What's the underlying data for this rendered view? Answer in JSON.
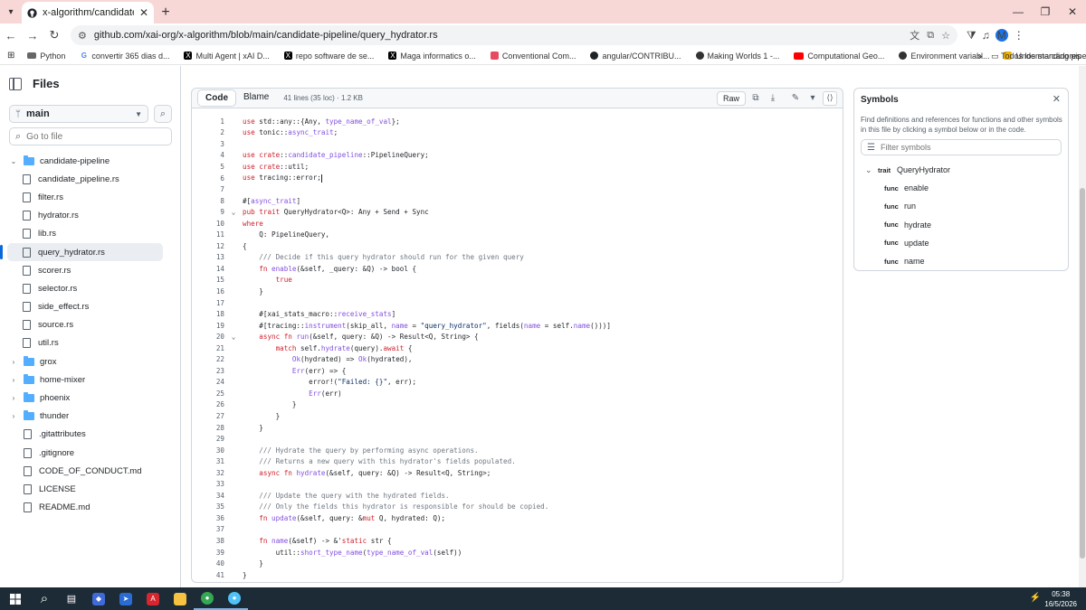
{
  "browser": {
    "tab_title": "x-algorithm/candidate-pipeline",
    "url": "github.com/xai-org/x-algorithm/blob/main/candidate-pipeline/query_hydrator.rs",
    "profile_initial": "M",
    "window_controls": [
      "—",
      "❐",
      "✕"
    ]
  },
  "bookmarks": {
    "items": [
      {
        "label": "Python",
        "icon": "folder-icon"
      },
      {
        "label": "convertir 365 dias d...",
        "icon": "google-icon"
      },
      {
        "label": "Multi Agent | xAI D...",
        "icon": "x-icon"
      },
      {
        "label": "repo software de se...",
        "icon": "x-icon"
      },
      {
        "label": "Maga informatics o...",
        "icon": "x-icon"
      },
      {
        "label": "Conventional Com...",
        "icon": "page-icon"
      },
      {
        "label": "angular/CONTRIBU...",
        "icon": "github-icon"
      },
      {
        "label": "Making Worlds 1 -...",
        "icon": "globe-icon"
      },
      {
        "label": "Computational Geo...",
        "icon": "youtube-icon"
      },
      {
        "label": "Environment variabl...",
        "icon": "cloud-icon"
      },
      {
        "label": "Understanding pipe...",
        "icon": "page-icon"
      }
    ],
    "all_bookmarks": "Todos los marcadores"
  },
  "sidebar": {
    "title": "Files",
    "branch": "main",
    "go_to_file_placeholder": "Go to file",
    "tree": [
      {
        "label": "candidate-pipeline",
        "type": "folder",
        "open": true,
        "depth": 0
      },
      {
        "label": "candidate_pipeline.rs",
        "type": "file",
        "depth": 1
      },
      {
        "label": "filter.rs",
        "type": "file",
        "depth": 1
      },
      {
        "label": "hydrator.rs",
        "type": "file",
        "depth": 1
      },
      {
        "label": "lib.rs",
        "type": "file",
        "depth": 1
      },
      {
        "label": "query_hydrator.rs",
        "type": "file",
        "depth": 1,
        "selected": true
      },
      {
        "label": "scorer.rs",
        "type": "file",
        "depth": 1
      },
      {
        "label": "selector.rs",
        "type": "file",
        "depth": 1
      },
      {
        "label": "side_effect.rs",
        "type": "file",
        "depth": 1
      },
      {
        "label": "source.rs",
        "type": "file",
        "depth": 1
      },
      {
        "label": "util.rs",
        "type": "file",
        "depth": 1
      },
      {
        "label": "grox",
        "type": "folder",
        "open": false,
        "depth": 0
      },
      {
        "label": "home-mixer",
        "type": "folder",
        "open": false,
        "depth": 0
      },
      {
        "label": "phoenix",
        "type": "folder",
        "open": false,
        "depth": 0
      },
      {
        "label": "thunder",
        "type": "folder",
        "open": false,
        "depth": 0
      },
      {
        "label": ".gitattributes",
        "type": "file",
        "depth": 0
      },
      {
        "label": ".gitignore",
        "type": "file",
        "depth": 0
      },
      {
        "label": "CODE_OF_CONDUCT.md",
        "type": "file",
        "depth": 0
      },
      {
        "label": "LICENSE",
        "type": "file",
        "depth": 0
      },
      {
        "label": "README.md",
        "type": "file",
        "depth": 0
      }
    ]
  },
  "code_view": {
    "tab_code": "Code",
    "tab_blame": "Blame",
    "meta": "41 lines (35 loc) · 1.2 KB",
    "raw_label": "Raw",
    "lines": [
      "use std::any::{Any, type_name_of_val};",
      "use tonic::async_trait;",
      "",
      "use crate::candidate_pipeline::PipelineQuery;",
      "use crate::util;",
      "use tracing::error;",
      "",
      "#[async_trait]",
      "pub trait QueryHydrator<Q>: Any + Send + Sync",
      "where",
      "    Q: PipelineQuery,",
      "{",
      "    /// Decide if this query hydrator should run for the given query",
      "    fn enable(&self, _query: &Q) -> bool {",
      "        true",
      "    }",
      "",
      "    #[xai_stats_macro::receive_stats]",
      "    #[tracing::instrument(skip_all, name = \"query_hydrator\", fields(name = self.name()))]",
      "    async fn run(&self, query: &Q) -> Result<Q, String> {",
      "        match self.hydrate(query).await {",
      "            Ok(hydrated) => Ok(hydrated),",
      "            Err(err) => {",
      "                error!(\"Failed: {}\", err);",
      "                Err(err)",
      "            }",
      "        }",
      "    }",
      "",
      "    /// Hydrate the query by performing async operations.",
      "    /// Returns a new query with this hydrator's fields populated.",
      "    async fn hydrate(&self, query: &Q) -> Result<Q, String>;",
      "",
      "    /// Update the query with the hydrated fields.",
      "    /// Only the fields this hydrator is responsible for should be copied.",
      "    fn update(&self, query: &mut Q, hydrated: Q);",
      "",
      "    fn name(&self) -> &'static str {",
      "        util::short_type_name(type_name_of_val(self))",
      "    }",
      "}"
    ],
    "foldable_lines": [
      9,
      20
    ]
  },
  "symbols": {
    "title": "Symbols",
    "description": "Find definitions and references for functions and other symbols in this file by clicking a symbol below or in the code.",
    "filter_placeholder": "Filter symbols",
    "items": [
      {
        "kind": "trait",
        "name": "QueryHydrator",
        "depth": 0
      },
      {
        "kind": "func",
        "name": "enable",
        "depth": 1
      },
      {
        "kind": "func",
        "name": "run",
        "depth": 1
      },
      {
        "kind": "func",
        "name": "hydrate",
        "depth": 1
      },
      {
        "kind": "func",
        "name": "update",
        "depth": 1
      },
      {
        "kind": "func",
        "name": "name",
        "depth": 1
      }
    ]
  },
  "taskbar": {
    "time": "05:38",
    "date": "16/5/2026"
  },
  "colors": {
    "tabstrip": "#f8d7d7",
    "accent": "#0969da",
    "keyword": "#cf222e",
    "function": "#8250df",
    "string": "#0a3069",
    "comment": "#6e7781"
  }
}
